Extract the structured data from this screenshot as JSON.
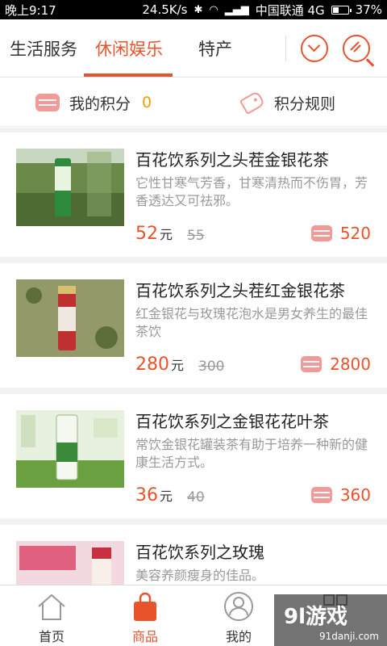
{
  "status_bar": {
    "time": "晚上9:17",
    "net_speed": "24.5K/s",
    "carrier": "中国联通 4G",
    "battery": "37%",
    "battery_level": 0.37
  },
  "top_tabs": [
    {
      "label": "生活服务"
    },
    {
      "label": "休闲娱乐",
      "active": true
    },
    {
      "label": "特产"
    }
  ],
  "points_bar": {
    "my_points_label": "我的积分",
    "my_points_value": "0",
    "rules_label": "积分规则"
  },
  "products": [
    {
      "title": "百花饮系列之头茬金银花茶",
      "desc": "它性甘寒气芳香，甘寒清热而不伤胃，芳香透达又可祛邪。",
      "price": "52",
      "unit": "元",
      "old_price": "55",
      "points": "520"
    },
    {
      "title": "百花饮系列之头茬红金银花茶",
      "desc": "红金银花与玫瑰花泡水是男女养生的最佳茶饮",
      "price": "280",
      "unit": "元",
      "old_price": "300",
      "points": "2800"
    },
    {
      "title": "百花饮系列之金银花花叶茶",
      "desc": "常饮金银花罐装茶有助于培养一种新的健康生活方式。",
      "price": "36",
      "unit": "元",
      "old_price": "40",
      "points": "360"
    },
    {
      "title": "百花饮系列之玫瑰",
      "desc": "美容养颜瘦身的佳品。",
      "price": "",
      "unit": "",
      "old_price": "",
      "points": ""
    }
  ],
  "bottom_nav": [
    {
      "label": "首页",
      "icon": "home-icon"
    },
    {
      "label": "商品",
      "icon": "shopping-bag-icon",
      "active": true
    },
    {
      "label": "我的",
      "icon": "user-icon"
    },
    {
      "label": "",
      "icon": "more-icon"
    }
  ],
  "watermark": {
    "logo": "9l游戏",
    "url": "91danji.com"
  },
  "colors": {
    "accent": "#e8532c",
    "points_value": "#f0a000",
    "icon_pink": "#f29a9a",
    "muted": "#999999"
  }
}
